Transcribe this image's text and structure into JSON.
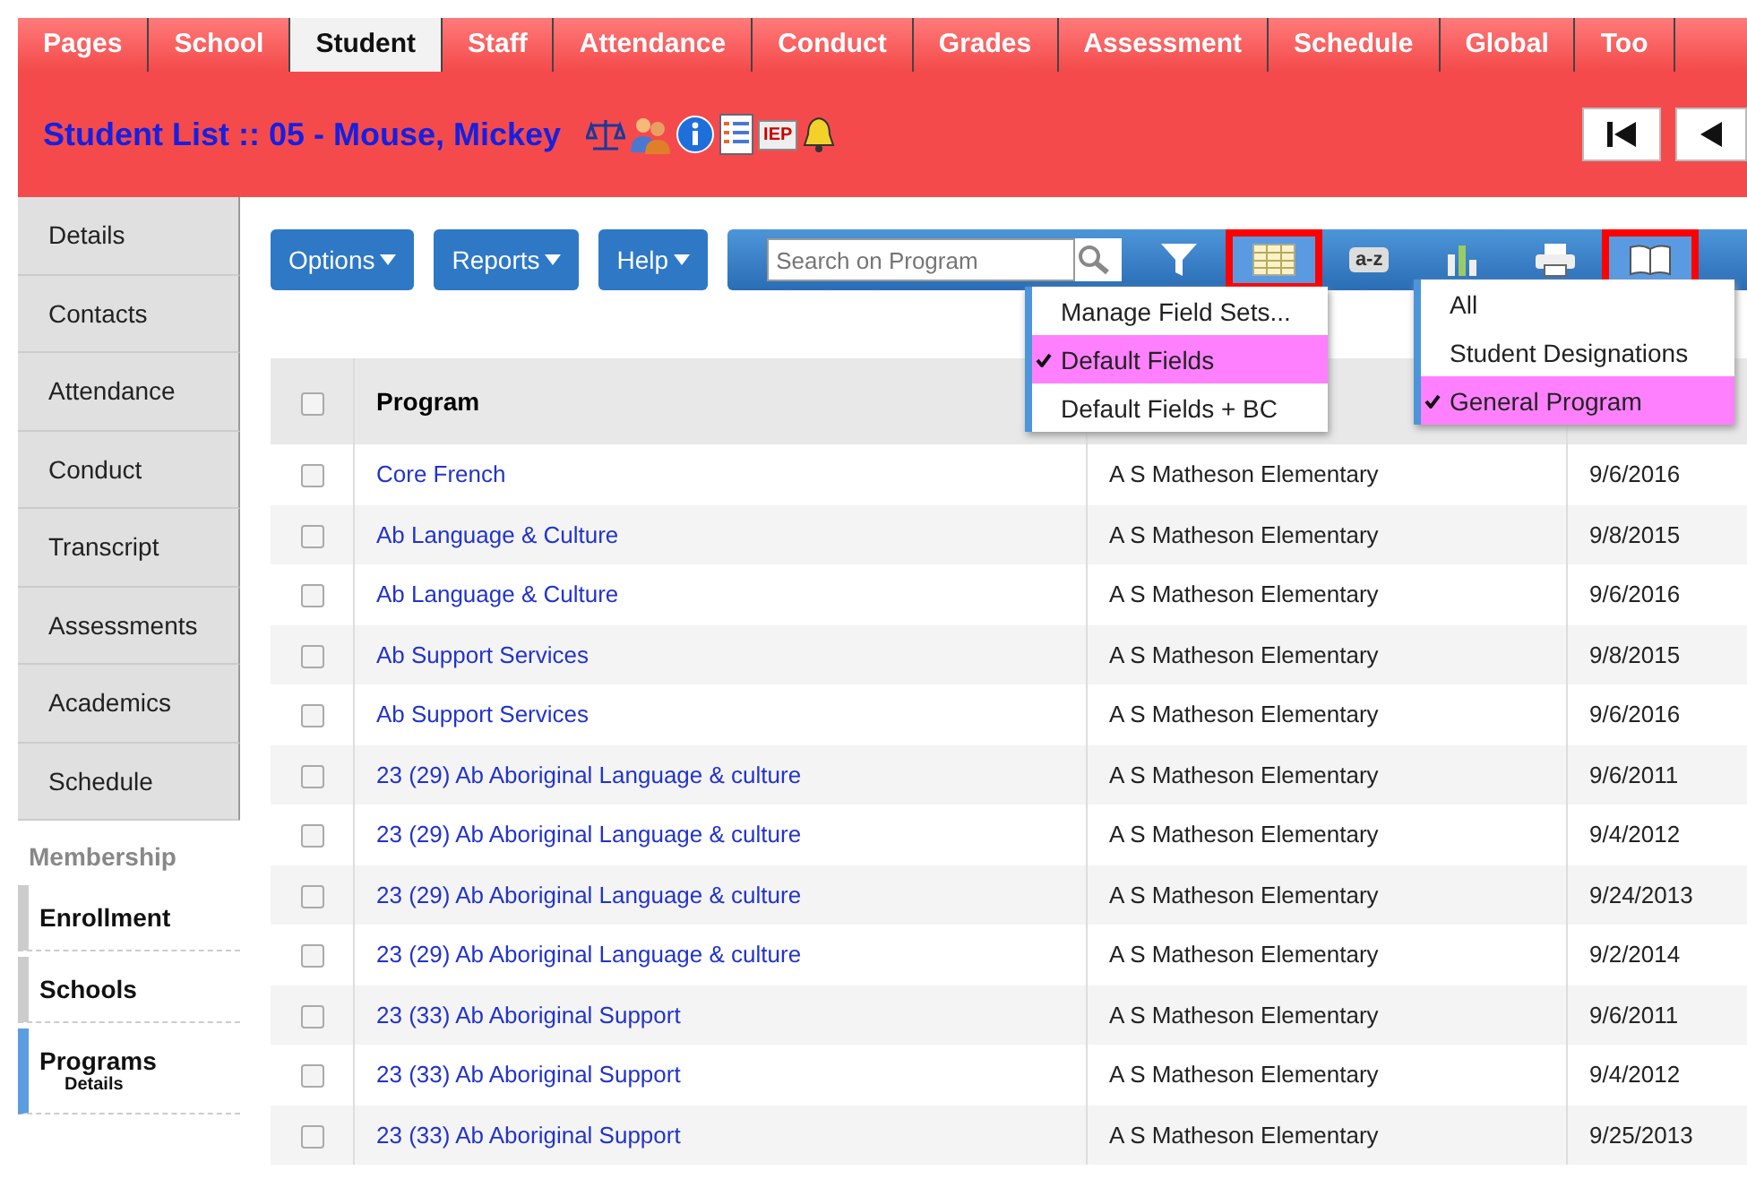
{
  "top_tabs": [
    {
      "label": "Pages",
      "selected": false
    },
    {
      "label": "School",
      "selected": false
    },
    {
      "label": "Student",
      "selected": true
    },
    {
      "label": "Staff",
      "selected": false
    },
    {
      "label": "Attendance",
      "selected": false
    },
    {
      "label": "Conduct",
      "selected": false
    },
    {
      "label": "Grades",
      "selected": false
    },
    {
      "label": "Assessment",
      "selected": false
    },
    {
      "label": "Schedule",
      "selected": false
    },
    {
      "label": "Global",
      "selected": false
    },
    {
      "label": "Too",
      "selected": false
    }
  ],
  "header": {
    "title_prefix": "Student List",
    "separator": "::",
    "student": "05 - Mouse, Mickey",
    "badge": "IEP"
  },
  "side_tabs": [
    "Details",
    "Contacts",
    "Attendance",
    "Conduct",
    "Transcript",
    "Assessments",
    "Academics",
    "Schedule"
  ],
  "side_section": {
    "title": "Membership",
    "items": [
      {
        "label": "Enrollment",
        "selected": false
      },
      {
        "label": "Schools",
        "selected": false
      },
      {
        "label": "Programs",
        "selected": true,
        "sub": "Details"
      }
    ]
  },
  "menu_buttons": [
    "Options",
    "Reports",
    "Help"
  ],
  "search": {
    "placeholder": "Search on Program"
  },
  "toolbar_icons": [
    {
      "kind": "filter",
      "highlighted": false
    },
    {
      "kind": "grid",
      "highlighted": true
    },
    {
      "kind": "sort",
      "label": "a-z",
      "highlighted": false
    },
    {
      "kind": "chart",
      "highlighted": false
    },
    {
      "kind": "print",
      "highlighted": false
    },
    {
      "kind": "book",
      "highlighted": true
    }
  ],
  "field_menu": [
    {
      "label": "Manage Field Sets...",
      "selected": false
    },
    {
      "label": "Default Fields",
      "selected": true
    },
    {
      "label": "Default Fields + BC",
      "selected": false
    }
  ],
  "view_menu": [
    {
      "label": "All",
      "selected": false
    },
    {
      "label": "Student Designations",
      "selected": false
    },
    {
      "label": "General Program",
      "selected": true
    }
  ],
  "table": {
    "select_all_checked": false,
    "columns": [
      "Program"
    ],
    "rows": [
      {
        "program": "Core French",
        "school": "A S Matheson Elementary",
        "date": "9/6/2016",
        "checked": false
      },
      {
        "program": "Ab Language & Culture",
        "school": "A S Matheson Elementary",
        "date": "9/8/2015",
        "checked": false
      },
      {
        "program": "Ab Language & Culture",
        "school": "A S Matheson Elementary",
        "date": "9/6/2016",
        "checked": false
      },
      {
        "program": "Ab Support Services",
        "school": "A S Matheson Elementary",
        "date": "9/8/2015",
        "checked": false
      },
      {
        "program": "Ab Support Services",
        "school": "A S Matheson Elementary",
        "date": "9/6/2016",
        "checked": false
      },
      {
        "program": "23 (29) Ab Aboriginal Language & culture",
        "school": "A S Matheson Elementary",
        "date": "9/6/2011",
        "checked": false
      },
      {
        "program": "23 (29) Ab Aboriginal Language & culture",
        "school": "A S Matheson Elementary",
        "date": "9/4/2012",
        "checked": false
      },
      {
        "program": "23 (29) Ab Aboriginal Language & culture",
        "school": "A S Matheson Elementary",
        "date": "9/24/2013",
        "checked": false
      },
      {
        "program": "23 (29) Ab Aboriginal Language & culture",
        "school": "A S Matheson Elementary",
        "date": "9/2/2014",
        "checked": false
      },
      {
        "program": "23 (33) Ab Aboriginal Support",
        "school": "A S Matheson Elementary",
        "date": "9/6/2011",
        "checked": false
      },
      {
        "program": "23 (33) Ab Aboriginal Support",
        "school": "A S Matheson Elementary",
        "date": "9/4/2012",
        "checked": false
      },
      {
        "program": "23 (33) Ab Aboriginal Support",
        "school": "A S Matheson Elementary",
        "date": "9/25/2013",
        "checked": false
      }
    ]
  }
}
